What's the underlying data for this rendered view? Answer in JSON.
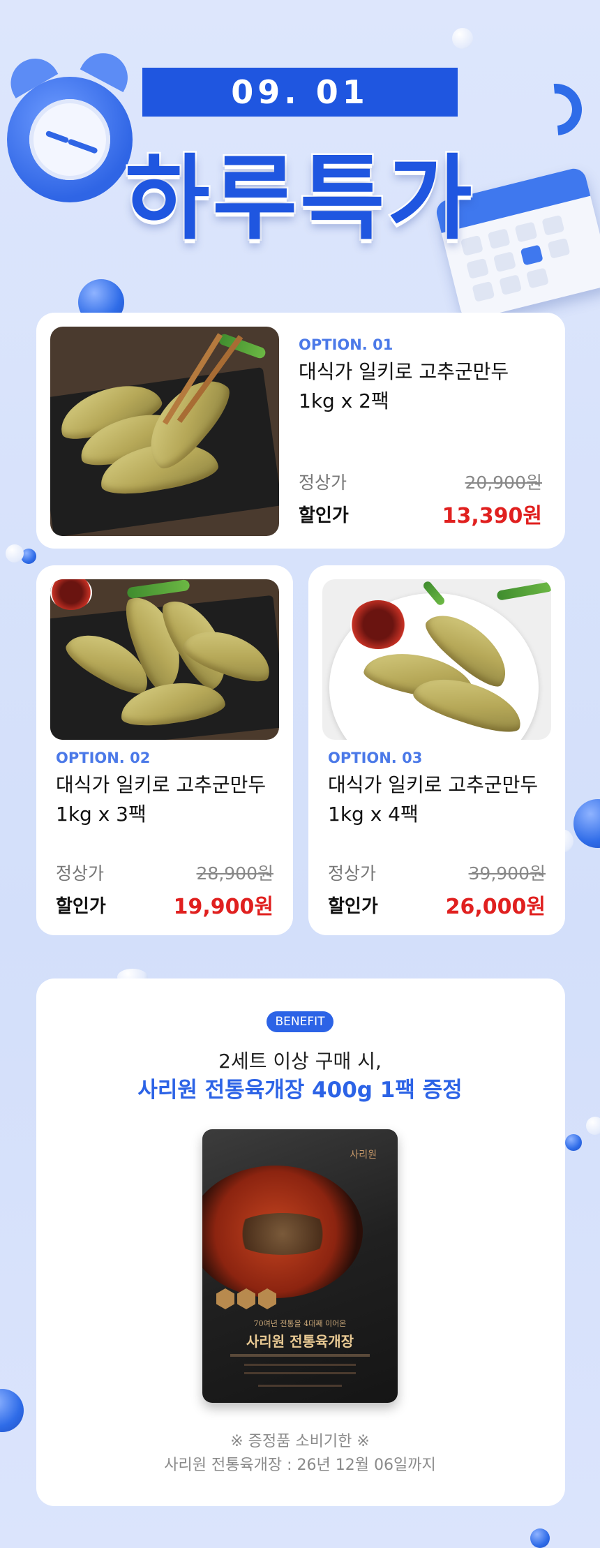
{
  "header": {
    "date": "09. 01",
    "title": "하루특가"
  },
  "options": [
    {
      "tag": "OPTION. 01",
      "name_line1": "대식가 일키로 고추군만두",
      "name_line2": "1kg x 2팩",
      "regular_label": "정상가",
      "regular_price": "20,900원",
      "sale_label": "할인가",
      "sale_price": "13,390원"
    },
    {
      "tag": "OPTION. 02",
      "name_line1": "대식가 일키로 고추군만두",
      "name_line2": "1kg x 3팩",
      "regular_label": "정상가",
      "regular_price": "28,900원",
      "sale_label": "할인가",
      "sale_price": "19,900원"
    },
    {
      "tag": "OPTION. 03",
      "name_line1": "대식가 일키로 고추군만두",
      "name_line2": "1kg x 4팩",
      "regular_label": "정상가",
      "regular_price": "39,900원",
      "sale_label": "할인가",
      "sale_price": "26,000원"
    }
  ],
  "benefit": {
    "badge": "BENEFIT",
    "line1": "2세트 이상 구매 시,",
    "line2": "사리원 전통육개장 400g 1팩 증정",
    "product": {
      "brand": "사리원",
      "subtitle": "70여년 전통을 4대째 이어온",
      "name": "사리원 전통육개장"
    },
    "note_line1": "※ 증정품 소비기한 ※",
    "note_line2": "사리원 전통육개장 : 26년 12월 06일까지"
  },
  "colors": {
    "background": "#d6e1fb",
    "accent": "#1f56e0",
    "option_tag": "#4b79e8",
    "sale_price": "#e0201f"
  }
}
